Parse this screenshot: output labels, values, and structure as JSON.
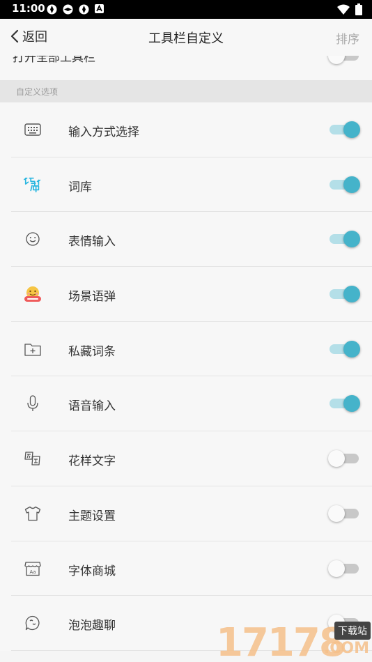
{
  "status_bar": {
    "time": "11:00"
  },
  "nav": {
    "back_label": "返回",
    "title": "工具栏自定义",
    "sort_label": "排序"
  },
  "partial_row": {
    "label": "打开全部工具栏"
  },
  "section": {
    "label": "自定义选项"
  },
  "items": [
    {
      "label": "输入方式选择",
      "icon": "keyboard-icon",
      "enabled": true
    },
    {
      "label": "词库",
      "icon": "lexicon-icon",
      "enabled": true
    },
    {
      "label": "表情输入",
      "icon": "emoji-icon",
      "enabled": true
    },
    {
      "label": "场景语弹",
      "icon": "scene-bubble-icon",
      "enabled": true
    },
    {
      "label": "私藏词条",
      "icon": "folder-add-icon",
      "enabled": true
    },
    {
      "label": "语音输入",
      "icon": "microphone-icon",
      "enabled": true
    },
    {
      "label": "花样文字",
      "icon": "fancy-text-icon",
      "enabled": false
    },
    {
      "label": "主题设置",
      "icon": "tshirt-icon",
      "enabled": false
    },
    {
      "label": "字体商城",
      "icon": "font-store-icon",
      "enabled": false
    },
    {
      "label": "泡泡趣聊",
      "icon": "bubble-chat-icon",
      "enabled": false
    }
  ],
  "watermark": {
    "text": "17178",
    "badge": "下载站",
    "suffix": ".COM"
  },
  "colors": {
    "accent": "#45b3ca",
    "accent_track": "#b4dfe8"
  }
}
